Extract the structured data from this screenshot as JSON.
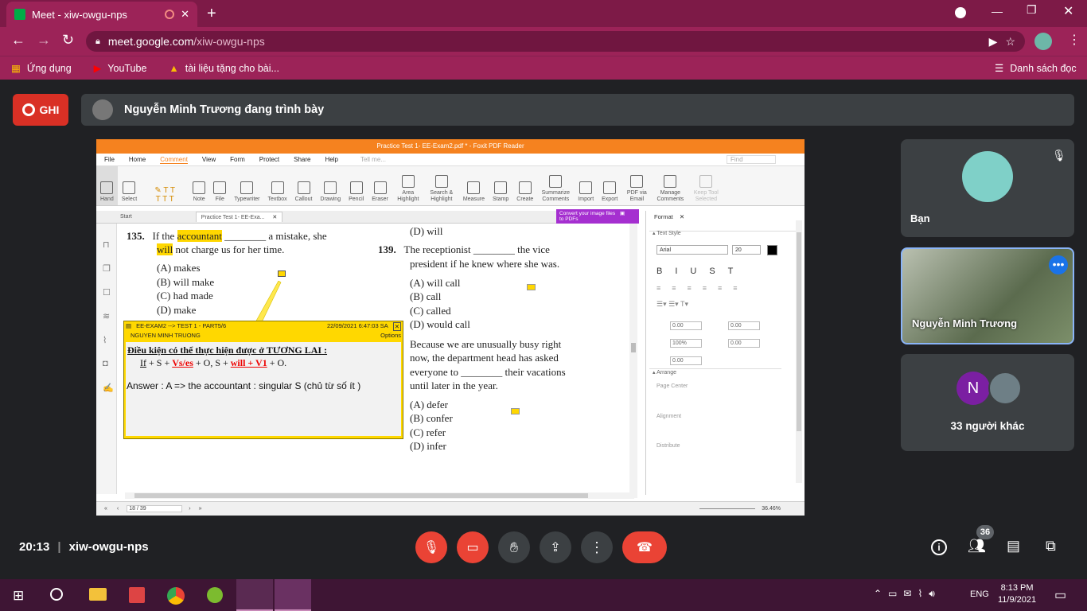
{
  "browser": {
    "tab_title": "Meet - xiw-owgu-nps",
    "url_host": "meet.google.com",
    "url_path": "/xiw-owgu-nps",
    "bookmarks": [
      "Ứng dụng",
      "YouTube",
      "tài liệu tặng cho bài..."
    ],
    "reading_list": "Danh sách đọc"
  },
  "meet": {
    "record_label": "GHI",
    "presenter_text": "Nguyễn Minh Trương đang trình bày",
    "self_label": "Bạn",
    "presenter_tile_name": "Nguyễn Minh Trương",
    "others_initial": "N",
    "others_label": "33 người khác",
    "time": "20:13",
    "meeting_code": "xiw-owgu-nps",
    "participants_count": "36"
  },
  "foxit": {
    "title": "Practice Test 1- EE-Exam2.pdf * - Foxit PDF Reader",
    "menu": [
      "File",
      "Home",
      "Comment",
      "View",
      "Form",
      "Protect",
      "Share",
      "Help"
    ],
    "tell_me": "Tell me...",
    "find": "Find",
    "ribbon": [
      "Hand",
      "Select",
      "Note",
      "File",
      "Typewriter",
      "Textbox",
      "Callout",
      "Drawing",
      "Pencil",
      "Eraser",
      "Area Highlight",
      "Search & Highlight",
      "Measure",
      "Stamp",
      "Create",
      "Summarize Comments",
      "Import",
      "Export",
      "PDF via Email",
      "Manage Comments",
      "Keep Tool Selected"
    ],
    "doc_tabs": [
      "Start",
      "Practice Test 1- EE-Exa..."
    ],
    "convert_banner": "Convert your image files to PDFs",
    "page_indicator": "18 / 39",
    "zoom": "36.46%",
    "format_panel": {
      "tab": "Format",
      "text_style": "Text Style",
      "font": "Arial",
      "size": "20",
      "spacing": [
        "0.00",
        "0.00",
        "100%",
        "0.00",
        "0.00"
      ],
      "arrange": "Arrange",
      "page_center": "Page Center",
      "alignment": "Alignment",
      "distribute": "Distribute"
    }
  },
  "exam": {
    "q135_num": "135.",
    "q135_a": "If the ",
    "q135_hl": "accountant",
    "q135_b": " ________ a mistake, she",
    "q135_hl2": "will",
    "q135_c": " not charge us for her time.",
    "q135_opts": [
      "(A)   makes",
      "(B)   will make",
      "(C)   had made",
      "(D)   make"
    ],
    "d_prev": "(D)   will",
    "q139_num": "139.",
    "q139_l1": "The receptionist ________ the vice",
    "q139_l2": "president if he knew where she was.",
    "q139_opts": [
      "(A)   will call",
      "(B)   call",
      "(C)   called",
      "(D)   would call"
    ],
    "q140_lines": [
      "Because we are unusually busy right",
      "now, the department head has asked",
      "everyone to ________ their vacations",
      "until later in the year."
    ],
    "q140_opts": [
      "(A)   defer",
      "(B)   confer",
      "(C)   refer",
      "(D)   infer"
    ]
  },
  "note": {
    "header": "EE-EXAM2 --> TEST 1 - PART5/6",
    "date": "22/09/2021 6:47:03 SA",
    "author": "NGUYEN MINH TRUONG",
    "options": "Options",
    "rule_title": "Điều kiện có thể thực hiện được ở TƯƠNG LAI",
    "f_if": "If",
    "f_s": " + S + ",
    "f_vs": "Vs/es",
    "f_mid": " + O, S + ",
    "f_will": "will + V1",
    "f_end": " + O.",
    "answer": "Answer : A => the accountant : singular S (chủ từ số ít )"
  },
  "taskbar": {
    "clock_time": "8:13 PM",
    "clock_date": "11/9/2021",
    "lang": "ENG"
  }
}
